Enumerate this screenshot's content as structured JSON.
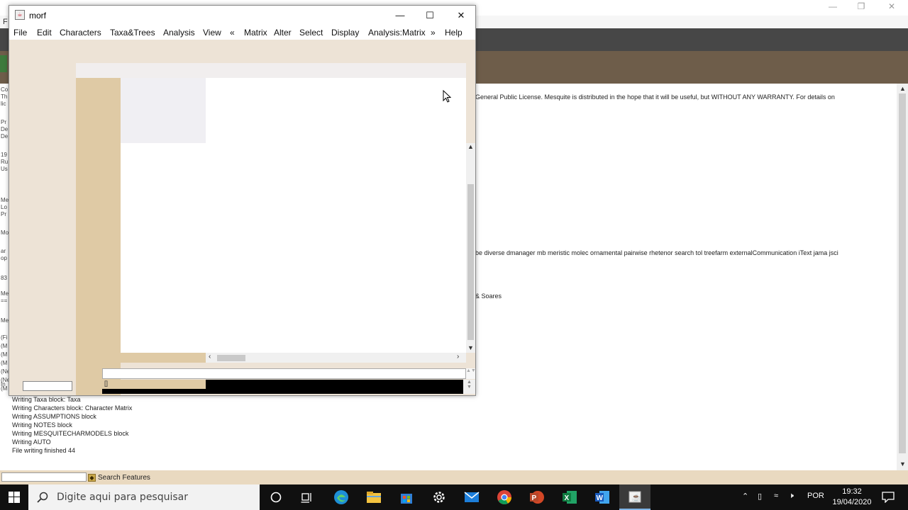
{
  "background_window": {
    "title_fragment": "F",
    "log_lines_right": [
      "General Public License.   Mesquite is distributed in the hope that it will be useful, but WITHOUT ANY WARRANTY.  For details on",
      "be diverse dmanager mb meristic molec ornamental pairwise rhetenor search tol treefarm externalCommunication iText jama jsci",
      "& Soares"
    ],
    "strip_fragments": [
      "Co",
      "Th",
      "lic",
      "Pr",
      "De",
      "De",
      "19",
      "Ru",
      "Us",
      "Me",
      "Lo",
      "Pr",
      "Mo",
      "ar",
      "op",
      "83",
      "Me",
      "==",
      "Me",
      "(Fi",
      "(M",
      "(M",
      "(M",
      "(Ne",
      "(Ne",
      "(M",
      "In"
    ],
    "log_lines_bottom": [
      "Writing Taxa block: Taxa",
      "Writing Characters block: Character Matrix",
      "Writing ASSUMPTIONS block",
      "Writing NOTES block",
      "Writing MESQUITECHARMODELS block",
      "Writing AUTO",
      "File writing finished 44"
    ],
    "search_features_label": "Search Features"
  },
  "morf_window": {
    "title": "morf",
    "menu": [
      {
        "label": "File"
      },
      {
        "label": "Edit"
      },
      {
        "label": "Characters"
      },
      {
        "label": "Taxa&Trees"
      },
      {
        "label": "Analysis"
      },
      {
        "label": "View"
      },
      {
        "label": "«"
      },
      {
        "label": "Matrix"
      },
      {
        "label": "Alter"
      },
      {
        "label": "Select"
      },
      {
        "label": "Display"
      },
      {
        "label": "Analysis:Matrix"
      },
      {
        "label": "»"
      },
      {
        "label": "Help"
      }
    ],
    "console_text": "[]"
  },
  "taskbar": {
    "search_placeholder": "Digite aqui para pesquisar",
    "language": "POR",
    "time": "19:32",
    "date": "19/04/2020"
  },
  "colors": {
    "beige_panel": "#dfcaa5",
    "brown_band": "#6e5d4a",
    "taskbar": "#101010"
  }
}
